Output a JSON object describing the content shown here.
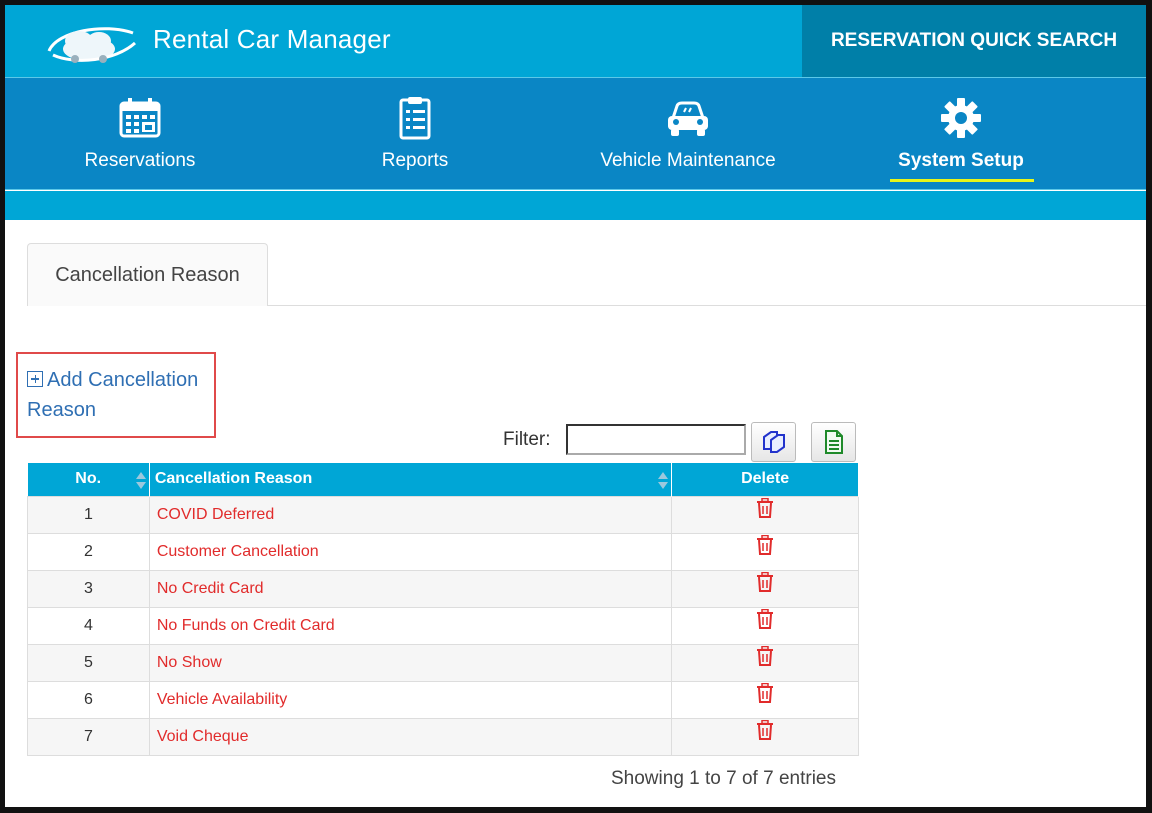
{
  "header": {
    "app_title": "Rental Car Manager",
    "quick_search_label": "RESERVATION QUICK SEARCH"
  },
  "nav": {
    "items": [
      {
        "label": "Reservations",
        "icon": "calendar-icon"
      },
      {
        "label": "Reports",
        "icon": "clipboard-list-icon"
      },
      {
        "label": "Vehicle Maintenance",
        "icon": "car-icon"
      },
      {
        "label": "System Setup",
        "icon": "gear-icon",
        "active": true
      }
    ]
  },
  "tabs": [
    {
      "label": "Cancellation Reason",
      "active": true
    }
  ],
  "add_link": {
    "label": "Add Cancellation Reason",
    "icon": "plus-square-icon"
  },
  "filter": {
    "label": "Filter:",
    "value": "",
    "copy_button_icon": "copy-icon",
    "export_button_icon": "spreadsheet-export-icon"
  },
  "table": {
    "columns": [
      "No.",
      "Cancellation Reason",
      "Delete"
    ],
    "rows": [
      {
        "no": "1",
        "reason": "COVID Deferred"
      },
      {
        "no": "2",
        "reason": "Customer Cancellation"
      },
      {
        "no": "3",
        "reason": "No Credit Card"
      },
      {
        "no": "4",
        "reason": "No Funds on Credit Card"
      },
      {
        "no": "5",
        "reason": "No Show"
      },
      {
        "no": "6",
        "reason": "Vehicle Availability"
      },
      {
        "no": "7",
        "reason": "Void Cheque"
      }
    ],
    "delete_icon": "trash-icon"
  },
  "footer": {
    "showing_text": "Showing 1 to 7 of 7 entries"
  },
  "colors": {
    "header_bg": "#00a6d6",
    "nav_bg": "#0a86c5",
    "quick_search_bg": "#007fa8",
    "active_underline": "#e8f51a",
    "reason_text": "#e12b2b",
    "link_text": "#2f6fb3",
    "highlight_box": "#e04a4a"
  }
}
